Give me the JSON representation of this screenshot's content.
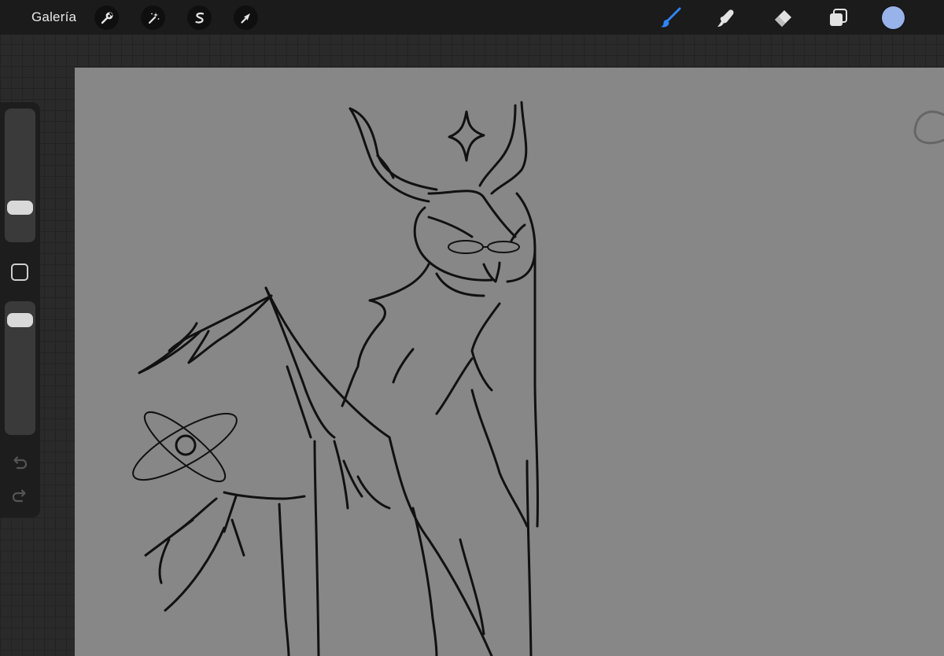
{
  "topbar": {
    "gallery_label": "Galería",
    "left_tools": [
      {
        "name": "actions",
        "icon": "wrench-icon"
      },
      {
        "name": "adjustments",
        "icon": "magic-wand-icon"
      },
      {
        "name": "selection",
        "icon": "selection-s-icon"
      },
      {
        "name": "transform",
        "icon": "arrow-cursor-icon"
      }
    ],
    "right_tools": [
      {
        "name": "brush",
        "icon": "brush-icon",
        "active": true
      },
      {
        "name": "smudge",
        "icon": "smudge-icon",
        "active": false
      },
      {
        "name": "eraser",
        "icon": "eraser-icon",
        "active": false
      },
      {
        "name": "layers",
        "icon": "layers-icon",
        "active": false
      }
    ],
    "current_color": "#98b2ea",
    "active_tool_color": "#2f86f6"
  },
  "sidebar": {
    "brush_size_level": 0.22,
    "brush_opacity_level": 0.92,
    "modify_icon": "square-modify-icon",
    "undo_icon": "undo-icon",
    "redo_icon": "redo-icon"
  },
  "canvas": {
    "background_color": "#878787",
    "stroke_color": "#111111"
  }
}
